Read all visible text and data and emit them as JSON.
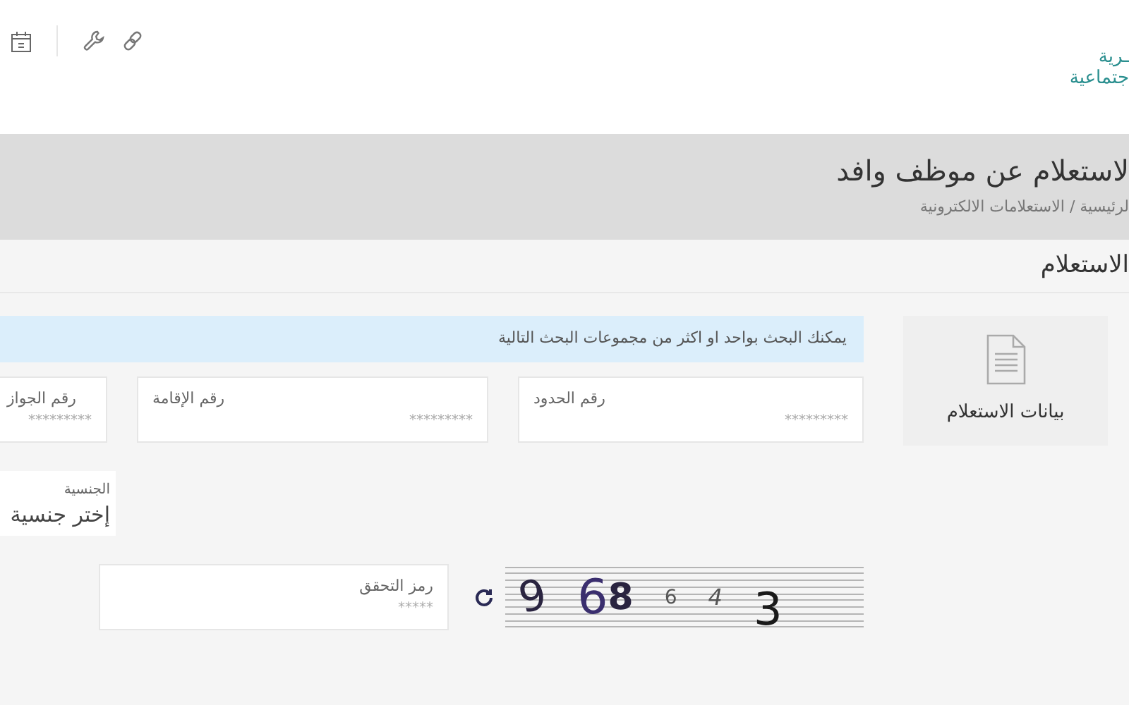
{
  "top_bar": {
    "logo_lines": [
      "ـرية",
      "جتماعية"
    ]
  },
  "page_header": {
    "title": "لاستعلام عن موظف وافد",
    "breadcrumb": "لرئيسية / الاستعلامات الالكترونية"
  },
  "section_title": "الاستعلام",
  "side_card": {
    "label": "بيانات الاستعلام"
  },
  "info_message": "يمكنك البحث بواحد او اكثر من مجموعات البحث التالية",
  "fields": [
    {
      "label": "رقم الحدود",
      "placeholder": "*********"
    },
    {
      "label": "رقم الإقامة",
      "placeholder": "*********"
    },
    {
      "label": "رقم الجواز",
      "placeholder": "*********"
    }
  ],
  "nationality": {
    "label": "الجنسية",
    "value": "إختر جنسية"
  },
  "captcha": {
    "text": "9 68 6 4 3",
    "label": "رمز التحقق",
    "placeholder": "*****"
  }
}
